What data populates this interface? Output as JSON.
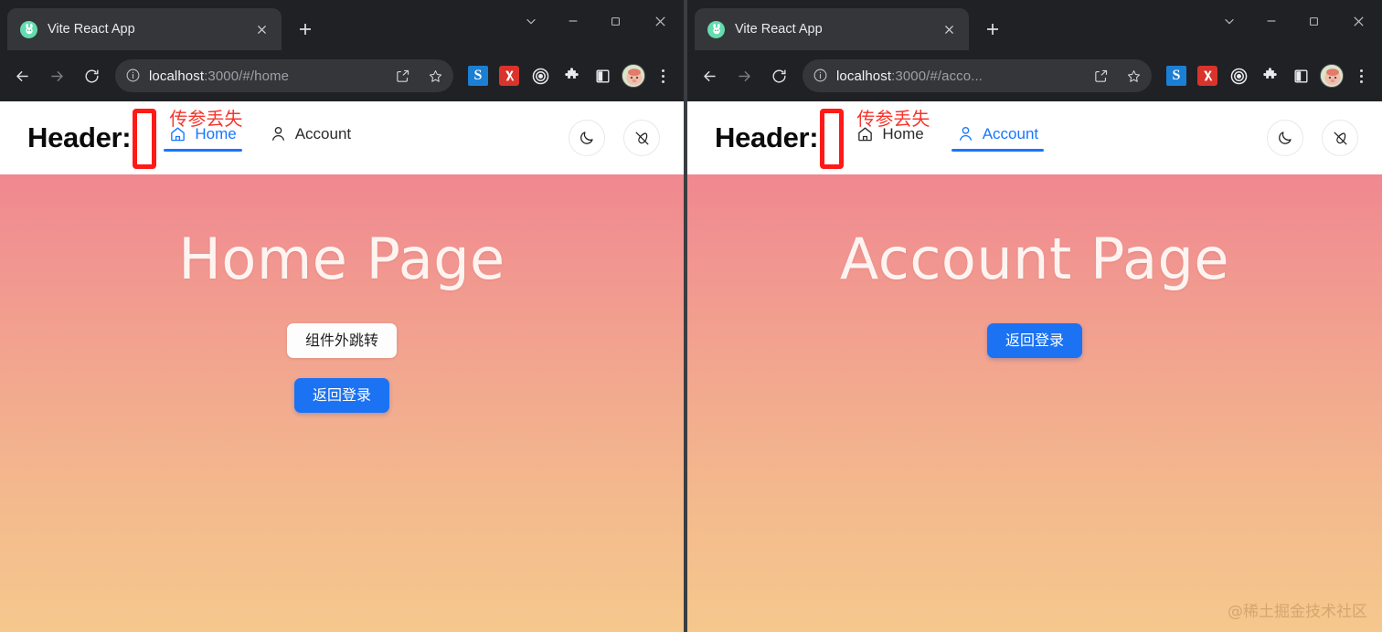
{
  "windows": [
    {
      "id": "left",
      "tab": {
        "title": "Vite React App",
        "favicon": "bunny-favicon",
        "close": "×"
      },
      "new_tab_label": "+",
      "window_controls": {
        "tab_search": "tab-search-icon",
        "minimize": "minimize-icon",
        "maximize": "maximize-icon",
        "close": "close-icon"
      },
      "toolbar": {
        "back": "back-arrow-icon",
        "forward": "forward-arrow-icon",
        "reload": "reload-icon",
        "site_info": "site-info-icon",
        "url_host": "localhost",
        "url_rest": ":3000/#/home",
        "share": "share-icon",
        "bookmark": "star-icon",
        "extensions": [
          "ext-s-icon",
          "ext-red-icon",
          "ext-target-icon",
          "ext-puzzle-icon",
          "ext-sidepanel-icon"
        ],
        "avatar": "profile-avatar",
        "menu": "kebab-menu-icon"
      },
      "app": {
        "header_title": "Header:",
        "annotation": "传参丢失",
        "nav": [
          {
            "label": "Home",
            "icon": "home-icon",
            "active": true
          },
          {
            "label": "Account",
            "icon": "person-icon",
            "active": false
          }
        ],
        "actions": [
          {
            "name": "dark-mode-toggle",
            "icon": "moon-icon"
          },
          {
            "name": "theme-brush-toggle",
            "icon": "brush-off-icon"
          }
        ],
        "page_title": "Home Page",
        "buttons": [
          {
            "label": "组件外跳转",
            "style": "light"
          },
          {
            "label": "返回登录",
            "style": "primary"
          }
        ],
        "watermark": ""
      }
    },
    {
      "id": "right",
      "tab": {
        "title": "Vite React App",
        "favicon": "bunny-favicon",
        "close": "×"
      },
      "new_tab_label": "+",
      "window_controls": {
        "tab_search": "tab-search-icon",
        "minimize": "minimize-icon",
        "maximize": "maximize-icon",
        "close": "close-icon"
      },
      "toolbar": {
        "back": "back-arrow-icon",
        "forward": "forward-arrow-icon",
        "reload": "reload-icon",
        "site_info": "site-info-icon",
        "url_host": "localhost",
        "url_rest": ":3000/#/acco...",
        "share": "share-icon",
        "bookmark": "star-icon",
        "extensions": [
          "ext-s-icon",
          "ext-red-icon",
          "ext-target-icon",
          "ext-puzzle-icon",
          "ext-sidepanel-icon"
        ],
        "avatar": "profile-avatar",
        "menu": "kebab-menu-icon"
      },
      "app": {
        "header_title": "Header:",
        "annotation": "传参丢失",
        "nav": [
          {
            "label": "Home",
            "icon": "home-icon",
            "active": false
          },
          {
            "label": "Account",
            "icon": "person-icon",
            "active": true
          }
        ],
        "actions": [
          {
            "name": "dark-mode-toggle",
            "icon": "moon-icon"
          },
          {
            "name": "theme-brush-toggle",
            "icon": "brush-off-icon"
          }
        ],
        "page_title": "Account Page",
        "buttons": [
          {
            "label": "返回登录",
            "style": "primary"
          }
        ],
        "watermark": "@稀土掘金技术社区"
      }
    }
  ],
  "colors": {
    "chrome_bg": "#202124",
    "tab_active": "#35363a",
    "annotation_red": "#f5352c",
    "redbox_border": "#ff1a18",
    "nav_active_blue": "#1677ff",
    "primary_button": "#1b72f2",
    "gradient_top": "#f08890",
    "gradient_bottom": "#f5c88d",
    "watermark": "#c99a63"
  }
}
